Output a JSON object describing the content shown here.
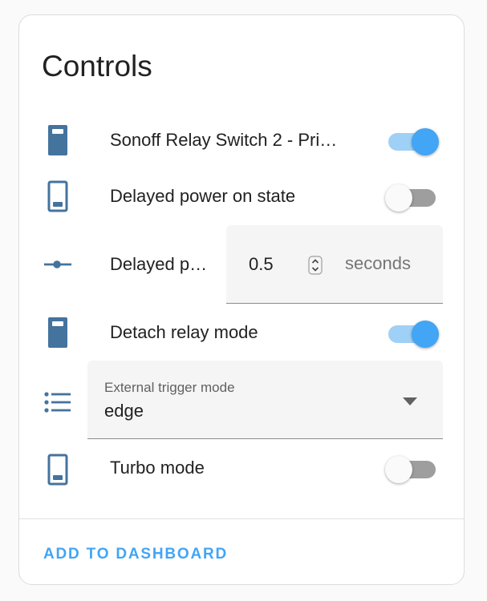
{
  "card": {
    "title": "Controls"
  },
  "rows": [
    {
      "label": "Sonoff Relay Switch 2 - Pri…",
      "icon": "relay-on-icon",
      "state": "on"
    },
    {
      "label": "Delayed power on state",
      "icon": "relay-off-icon",
      "state": "off"
    },
    {
      "label": "Delayed p…",
      "icon": "slider-icon",
      "value": "0.5",
      "unit": "seconds"
    },
    {
      "label": "Detach relay mode",
      "icon": "relay-on-icon",
      "state": "on"
    },
    {
      "icon": "list-icon",
      "select_label": "External trigger mode",
      "select_value": "edge"
    },
    {
      "label": "Turbo mode",
      "icon": "relay-off-icon",
      "state": "off"
    }
  ],
  "footer": {
    "action_label": "ADD TO DASHBOARD"
  },
  "colors": {
    "accent": "#42a5f5",
    "icon": "#44739e",
    "text": "#212121"
  }
}
